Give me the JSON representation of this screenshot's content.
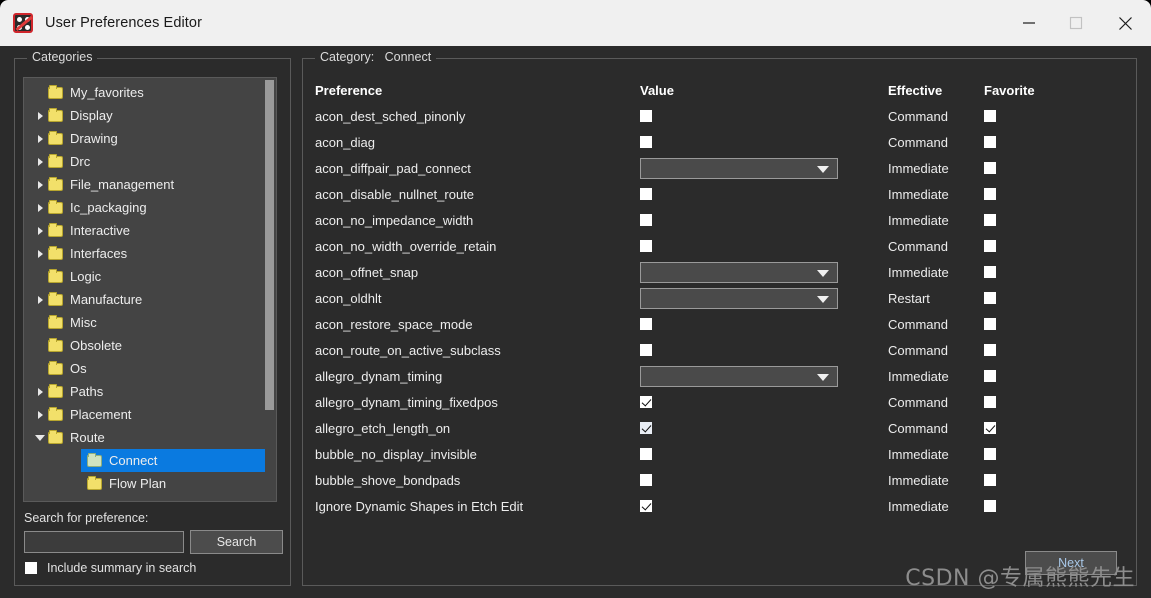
{
  "window": {
    "title": "User Preferences Editor",
    "icon": "allegro-app-icon",
    "controls": {
      "minimize": "minimize-icon",
      "maximize": "maximize-icon",
      "close": "close-icon"
    }
  },
  "colors": {
    "titlebar_bg": "#f0f0f0",
    "window_bg": "#2b2b2b",
    "tree_bg": "#444444",
    "selection": "#0a7ae0",
    "folder": "#f2e06a",
    "text": "#ededed",
    "next_label": "#a9c8e8"
  },
  "sidebar": {
    "group_label": "Categories",
    "items": [
      {
        "label": "My_favorites",
        "indent": 1,
        "arrow": "none",
        "selected": false,
        "folder": "closed"
      },
      {
        "label": "Display",
        "indent": 0,
        "arrow": "collapsed",
        "selected": false,
        "folder": "closed"
      },
      {
        "label": "Drawing",
        "indent": 0,
        "arrow": "collapsed",
        "selected": false,
        "folder": "closed"
      },
      {
        "label": "Drc",
        "indent": 0,
        "arrow": "collapsed",
        "selected": false,
        "folder": "closed"
      },
      {
        "label": "File_management",
        "indent": 0,
        "arrow": "collapsed",
        "selected": false,
        "folder": "closed"
      },
      {
        "label": "Ic_packaging",
        "indent": 0,
        "arrow": "collapsed",
        "selected": false,
        "folder": "closed"
      },
      {
        "label": "Interactive",
        "indent": 0,
        "arrow": "collapsed",
        "selected": false,
        "folder": "closed"
      },
      {
        "label": "Interfaces",
        "indent": 0,
        "arrow": "collapsed",
        "selected": false,
        "folder": "closed"
      },
      {
        "label": "Logic",
        "indent": 1,
        "arrow": "none",
        "selected": false,
        "folder": "closed"
      },
      {
        "label": "Manufacture",
        "indent": 0,
        "arrow": "collapsed",
        "selected": false,
        "folder": "closed"
      },
      {
        "label": "Misc",
        "indent": 1,
        "arrow": "none",
        "selected": false,
        "folder": "closed"
      },
      {
        "label": "Obsolete",
        "indent": 1,
        "arrow": "none",
        "selected": false,
        "folder": "closed"
      },
      {
        "label": "Os",
        "indent": 1,
        "arrow": "none",
        "selected": false,
        "folder": "closed"
      },
      {
        "label": "Paths",
        "indent": 0,
        "arrow": "collapsed",
        "selected": false,
        "folder": "closed"
      },
      {
        "label": "Placement",
        "indent": 0,
        "arrow": "collapsed",
        "selected": false,
        "folder": "closed"
      },
      {
        "label": "Route",
        "indent": 0,
        "arrow": "expanded",
        "selected": false,
        "folder": "closed"
      },
      {
        "label": "Connect",
        "indent": 2,
        "arrow": "none",
        "selected": true,
        "folder": "open"
      },
      {
        "label": "Flow Plan",
        "indent": 2,
        "arrow": "none",
        "selected": false,
        "folder": "closed"
      }
    ],
    "search": {
      "label": "Search for preference:",
      "value": "",
      "placeholder": "",
      "button_label": "Search",
      "include_summary_label": "Include summary in search",
      "include_summary_checked": false
    }
  },
  "main": {
    "group_label": "Category:   Connect",
    "headers": {
      "preference": "Preference",
      "value": "Value",
      "effective": "Effective",
      "favorite": "Favorite"
    },
    "rows": [
      {
        "preference": "acon_dest_sched_pinonly",
        "control": "checkbox",
        "checked": false,
        "effective": "Command",
        "favorite": false
      },
      {
        "preference": "acon_diag",
        "control": "checkbox",
        "checked": false,
        "effective": "Command",
        "favorite": false
      },
      {
        "preference": "acon_diffpair_pad_connect",
        "control": "dropdown",
        "value": "",
        "effective": "Immediate",
        "favorite": false
      },
      {
        "preference": "acon_disable_nullnet_route",
        "control": "checkbox",
        "checked": false,
        "effective": "Immediate",
        "favorite": false
      },
      {
        "preference": "acon_no_impedance_width",
        "control": "checkbox",
        "checked": false,
        "effective": "Immediate",
        "favorite": false
      },
      {
        "preference": "acon_no_width_override_retain",
        "control": "checkbox",
        "checked": false,
        "effective": "Command",
        "favorite": false
      },
      {
        "preference": "acon_offnet_snap",
        "control": "dropdown",
        "value": "",
        "effective": "Immediate",
        "favorite": false
      },
      {
        "preference": "acon_oldhlt",
        "control": "dropdown",
        "value": "",
        "effective": "Restart",
        "favorite": false
      },
      {
        "preference": "acon_restore_space_mode",
        "control": "checkbox",
        "checked": false,
        "effective": "Command",
        "favorite": false
      },
      {
        "preference": "acon_route_on_active_subclass",
        "control": "checkbox",
        "checked": false,
        "effective": "Command",
        "favorite": false
      },
      {
        "preference": "allegro_dynam_timing",
        "control": "dropdown",
        "value": "",
        "effective": "Immediate",
        "favorite": false
      },
      {
        "preference": "allegro_dynam_timing_fixedpos",
        "control": "checkbox",
        "checked": true,
        "effective": "Command",
        "favorite": false
      },
      {
        "preference": "allegro_etch_length_on",
        "control": "checkbox",
        "checked": true,
        "effective": "Command",
        "favorite": true
      },
      {
        "preference": "bubble_no_display_invisible",
        "control": "checkbox",
        "checked": false,
        "effective": "Immediate",
        "favorite": false
      },
      {
        "preference": "bubble_shove_bondpads",
        "control": "checkbox",
        "checked": false,
        "effective": "Immediate",
        "favorite": false
      },
      {
        "preference": "Ignore Dynamic Shapes in Etch Edit",
        "control": "checkbox",
        "checked": true,
        "effective": "Immediate",
        "favorite": false
      }
    ],
    "next_button_label": "Next"
  },
  "watermark": "CSDN @专属熊熊先生"
}
